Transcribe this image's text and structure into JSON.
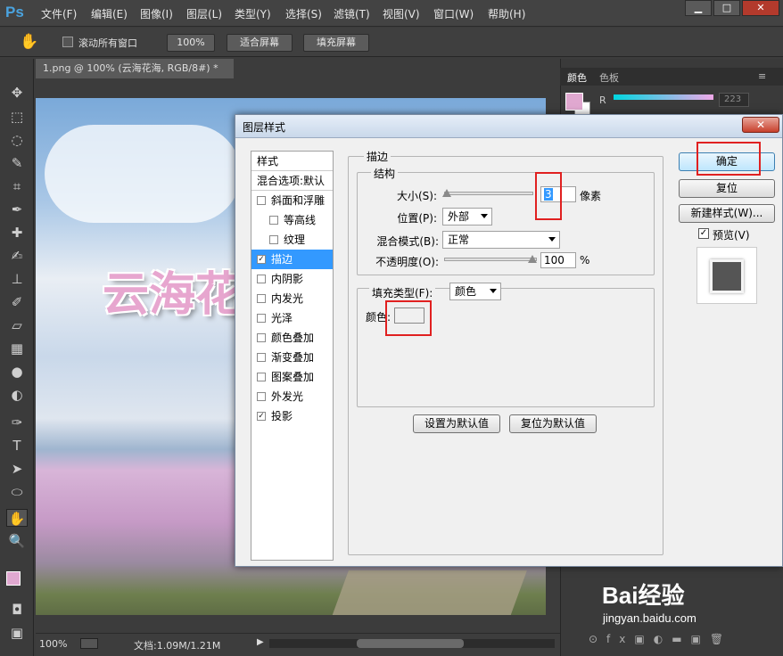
{
  "app": {
    "logo": "Ps"
  },
  "menu": [
    "文件(F)",
    "编辑(E)",
    "图像(I)",
    "图层(L)",
    "类型(Y)",
    "选择(S)",
    "滤镜(T)",
    "视图(V)",
    "窗口(W)",
    "帮助(H)"
  ],
  "window_controls": {
    "minimize": "▁",
    "restore": "□",
    "close": "✕"
  },
  "options_bar": {
    "scroll_all_label": "滚动所有窗口",
    "zoom_100_label": "100%",
    "fit_screen_label": "适合屏幕",
    "fill_screen_label": "填充屏幕"
  },
  "document": {
    "tab_title": "1.png @ 100% (云海花海, RGB/8#) *",
    "canvas_text": "云海花"
  },
  "status": {
    "zoom": "100%",
    "doc_info": "文档:1.09M/1.21M"
  },
  "color_panel": {
    "tabs": [
      "颜色",
      "色板"
    ],
    "channel_label": "R",
    "channel_value": "223",
    "fg_color": "#e0a8d0"
  },
  "dialog": {
    "title": "图层样式",
    "close_label": "✕",
    "styles_header": "样式",
    "blend_options": "混合选项:默认",
    "styles": [
      {
        "label": "斜面和浮雕",
        "checked": false,
        "indent": false
      },
      {
        "label": "等高线",
        "checked": false,
        "indent": true
      },
      {
        "label": "纹理",
        "checked": false,
        "indent": true
      },
      {
        "label": "描边",
        "checked": true,
        "indent": false,
        "selected": true
      },
      {
        "label": "内阴影",
        "checked": false,
        "indent": false
      },
      {
        "label": "内发光",
        "checked": false,
        "indent": false
      },
      {
        "label": "光泽",
        "checked": false,
        "indent": false
      },
      {
        "label": "颜色叠加",
        "checked": false,
        "indent": false
      },
      {
        "label": "渐变叠加",
        "checked": false,
        "indent": false
      },
      {
        "label": "图案叠加",
        "checked": false,
        "indent": false
      },
      {
        "label": "外发光",
        "checked": false,
        "indent": false
      },
      {
        "label": "投影",
        "checked": true,
        "indent": false
      }
    ],
    "stroke": {
      "section_title": "描边",
      "structure_title": "结构",
      "size_label": "大小(S):",
      "size_value": "3",
      "size_unit": "像素",
      "position_label": "位置(P):",
      "position_value": "外部",
      "blend_label": "混合模式(B):",
      "blend_value": "正常",
      "opacity_label": "不透明度(O):",
      "opacity_value": "100",
      "opacity_unit": "%",
      "fill_type_label": "填充类型(F):",
      "fill_type_value": "颜色",
      "color_label": "颜色:",
      "color_value": "#f0f0f0"
    },
    "buttons": {
      "ok": "确定",
      "reset": "复位",
      "new_style": "新建样式(W)...",
      "preview": "预览(V)",
      "set_default": "设置为默认值",
      "reset_default": "复位为默认值"
    }
  },
  "watermark": {
    "brand": "Bai经验",
    "url": "jingyan.baidu.com"
  }
}
